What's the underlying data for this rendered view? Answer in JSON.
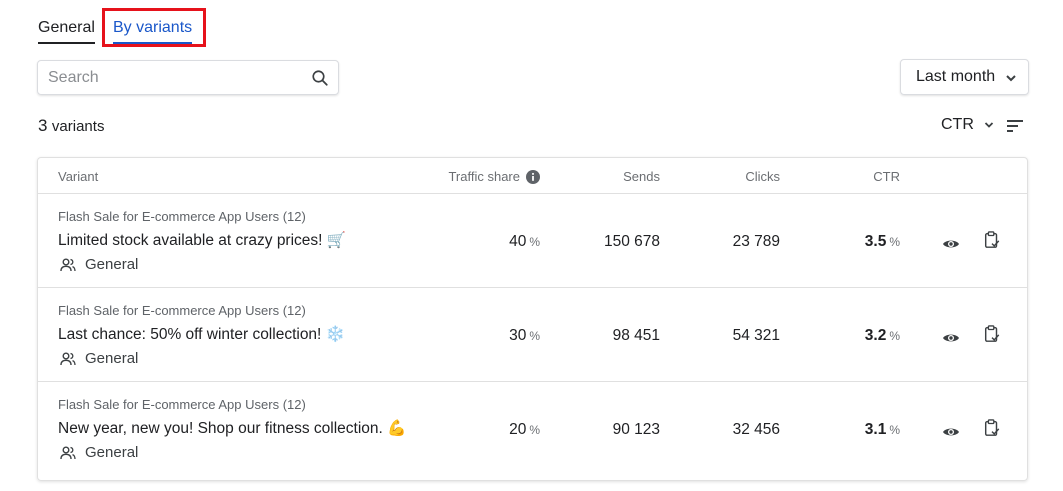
{
  "tabs": [
    {
      "label": "General",
      "active": false
    },
    {
      "label": "By variants",
      "active": true
    }
  ],
  "search": {
    "placeholder": "Search",
    "value": ""
  },
  "period": {
    "selected": "Last month"
  },
  "summary": {
    "count": "3",
    "count_label": "variants"
  },
  "sort": {
    "label": "CTR"
  },
  "table": {
    "columns": {
      "variant": "Variant",
      "traffic": "Traffic share",
      "sends": "Sends",
      "clicks": "Clicks",
      "ctr": "CTR"
    },
    "rows": [
      {
        "campaign": "Flash Sale for E-commerce App Users (12)",
        "message": "Limited stock available at crazy prices! 🛒",
        "segment": "General",
        "traffic": "40",
        "traffic_unit": "%",
        "sends": "150 678",
        "clicks": "23 789",
        "ctr": "3.5",
        "ctr_unit": "%"
      },
      {
        "campaign": "Flash Sale for E-commerce App Users (12)",
        "message": "Last chance: 50% off winter collection! ❄️",
        "segment": "General",
        "traffic": "30",
        "traffic_unit": "%",
        "sends": "98 451",
        "clicks": "54 321",
        "ctr": "3.2",
        "ctr_unit": "%"
      },
      {
        "campaign": "Flash Sale for E-commerce App Users (12)",
        "message": "New year, new you! Shop our fitness collection. 💪",
        "segment": "General",
        "traffic": "20",
        "traffic_unit": "%",
        "sends": "90 123",
        "clicks": "32 456",
        "ctr": "3.1",
        "ctr_unit": "%"
      }
    ]
  },
  "icons": {
    "search": "search-icon",
    "period_chevron": "chevron-down-icon",
    "sort_chevron": "chevron-down-icon",
    "sort_lines": "sort-icon",
    "traffic_info": "info-icon",
    "segment": "people-icon",
    "view": "eye-icon",
    "copy": "clipboard-check-icon"
  },
  "colors": {
    "active_tab": "#1a57c9",
    "highlight": "#e6121b",
    "text": "#202124",
    "muted": "#6b6e72",
    "border": "#e0e0e0"
  }
}
